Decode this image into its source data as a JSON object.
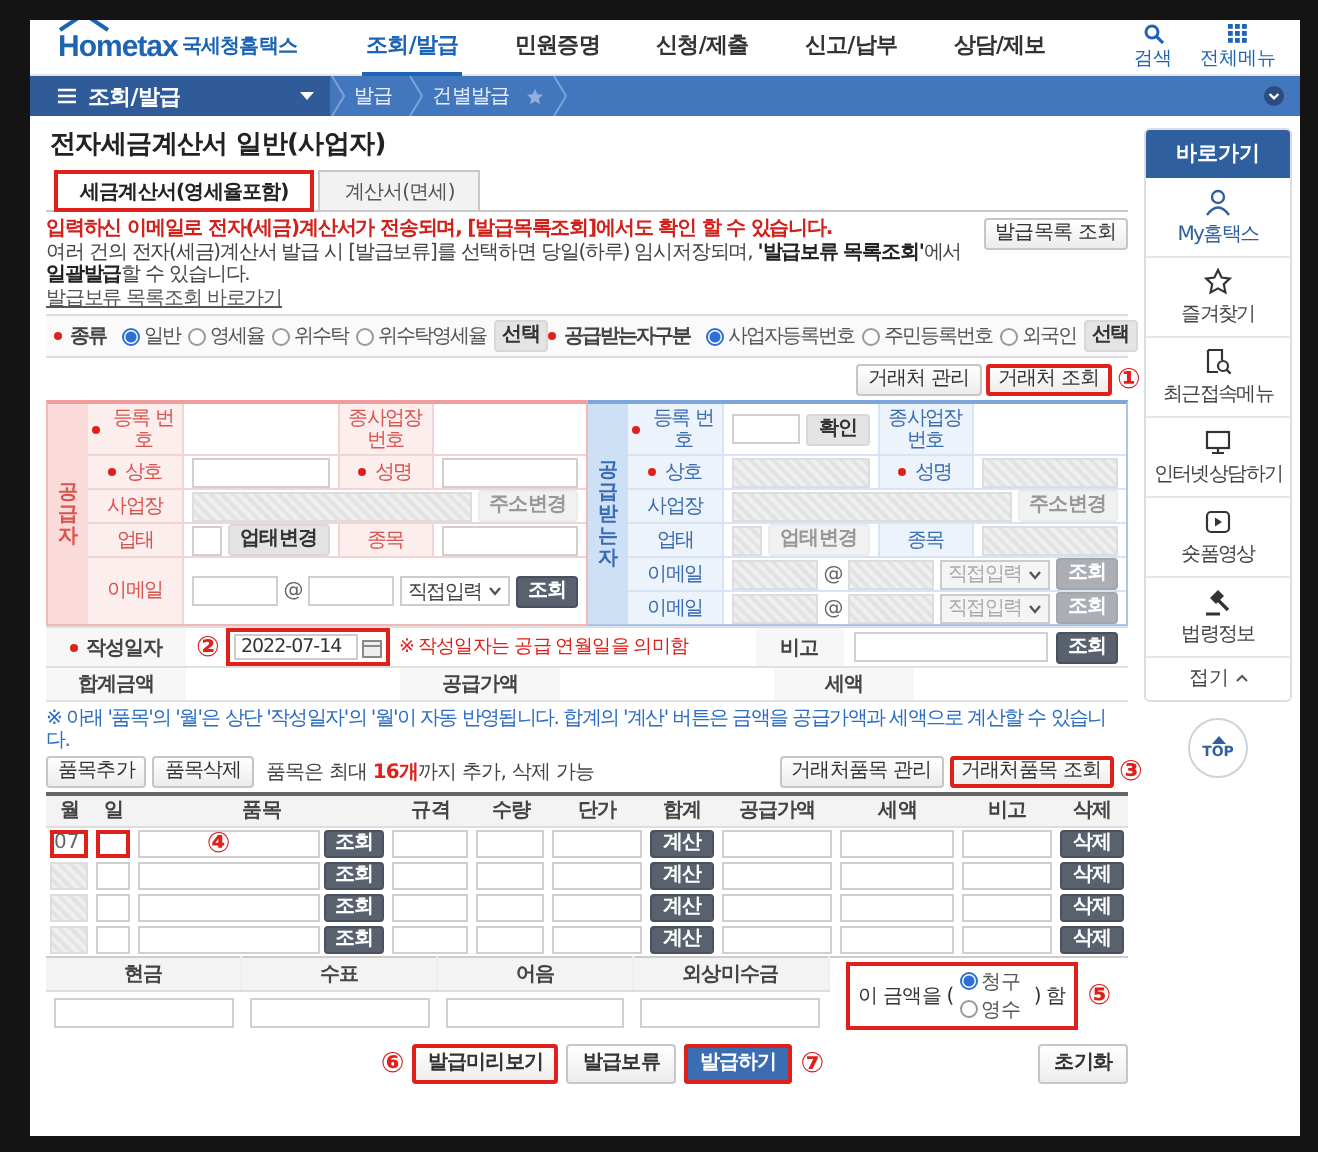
{
  "header": {
    "logo": "Hometax",
    "brand": "국세청홈택스",
    "nav": [
      {
        "label": "조회/발급",
        "selected": true
      },
      {
        "label": "민원증명",
        "selected": false
      },
      {
        "label": "신청/제출",
        "selected": false
      },
      {
        "label": "신고/납부",
        "selected": false
      },
      {
        "label": "상담/제보",
        "selected": false
      }
    ],
    "utilities": [
      {
        "kind": "search",
        "label": "검색"
      },
      {
        "kind": "menu",
        "label": "전체메뉴"
      }
    ]
  },
  "breadcrumb": {
    "menu": "조회/발급",
    "items": [
      "발급",
      "건별발급"
    ],
    "favorite": false
  },
  "page_title": "전자세금계산서 일반(사업자)",
  "tabs": [
    {
      "label": "세금계산서(영세율포함)",
      "selected": true,
      "highlighted": true
    },
    {
      "label": "계산서(면세)",
      "selected": false,
      "highlighted": false
    }
  ],
  "notices": [
    {
      "kind": "warning",
      "text": "입력하신 이메일로 전자(세금)계산서가 전송되며, [발급목록조회]에서도 확인 할 수 있습니다."
    },
    {
      "kind": "info",
      "text": "여러 건의 전자(세금)계산서 발급 시 [발급보류]를 선택하면 당일(하루) 임시저장되며, **'발급보류 목록조회'**에서 **일괄발급**할 수 있습니다."
    },
    {
      "kind": "link",
      "text": "발급보류 목록조회 바로가기"
    }
  ],
  "list_button": "발급목록 조회",
  "type_row": [
    {
      "label": "종류",
      "required": true,
      "options": [
        {
          "label": "일반",
          "selected": true
        },
        {
          "label": "영세율",
          "selected": false
        },
        {
          "label": "위수탁",
          "selected": false
        },
        {
          "label": "위수탁영세율",
          "selected": false
        }
      ],
      "button": "선택"
    },
    {
      "label": "공급받는자구분",
      "required": true,
      "options": [
        {
          "label": "사업자등록번호",
          "selected": true
        },
        {
          "label": "주민등록번호",
          "selected": false
        },
        {
          "label": "외국인",
          "selected": false
        }
      ],
      "button": "선택"
    }
  ],
  "partner_buttons": [
    {
      "label": "거래처 관리",
      "highlighted": false
    },
    {
      "label": "거래처 조회",
      "highlighted": true,
      "callout": "①"
    }
  ],
  "supplier": {
    "title": "공급자",
    "rows": [
      [
        {
          "label": "등록 번호",
          "required": true
        },
        {
          "label": "종사업장 번호",
          "required": false
        }
      ],
      [
        {
          "label": "상호",
          "required": true,
          "controls": [
            {
              "kind": "input",
              "disabled": false
            }
          ]
        },
        {
          "label": "성명",
          "required": true,
          "controls": [
            {
              "kind": "input",
              "disabled": false
            }
          ]
        }
      ],
      [
        {
          "label": "사업장",
          "required": false,
          "controls": [
            {
              "kind": "input",
              "disabled": true
            },
            {
              "kind": "button",
              "label": "주소변경",
              "disabled": true
            }
          ]
        }
      ],
      [
        {
          "label": "업태",
          "required": false,
          "controls": [
            {
              "kind": "input",
              "disabled": false
            },
            {
              "kind": "button",
              "label": "업태변경",
              "disabled": false
            }
          ]
        },
        {
          "label": "종목",
          "required": false,
          "controls": [
            {
              "kind": "input",
              "disabled": false
            }
          ]
        }
      ],
      [
        {
          "label": "이메일",
          "required": false,
          "controls": [
            {
              "kind": "input",
              "disabled": false
            },
            {
              "kind": "text",
              "text": "@"
            },
            {
              "kind": "input",
              "disabled": false
            },
            {
              "kind": "select",
              "value": "직접입력",
              "disabled": false
            },
            {
              "kind": "search_button",
              "label": "조회",
              "disabled": false
            }
          ]
        }
      ]
    ]
  },
  "receiver": {
    "title": "공급받는자",
    "rows": [
      [
        {
          "label": "등록 번호",
          "required": true,
          "controls": [
            {
              "kind": "input",
              "disabled": false
            },
            {
              "kind": "button",
              "label": "확인",
              "disabled": false
            }
          ]
        },
        {
          "label": "종사업장 번호",
          "required": false
        }
      ],
      [
        {
          "label": "상호",
          "required": true,
          "controls": [
            {
              "kind": "input",
              "disabled": true
            }
          ]
        },
        {
          "label": "성명",
          "required": true,
          "controls": [
            {
              "kind": "input",
              "disabled": true
            }
          ]
        }
      ],
      [
        {
          "label": "사업장",
          "required": false,
          "controls": [
            {
              "kind": "input",
              "disabled": true
            },
            {
              "kind": "button",
              "label": "주소변경",
              "disabled": true
            }
          ]
        }
      ],
      [
        {
          "label": "업태",
          "required": false,
          "controls": [
            {
              "kind": "input",
              "disabled": true
            },
            {
              "kind": "button",
              "label": "업태변경",
              "disabled": true
            }
          ]
        },
        {
          "label": "종목",
          "required": false,
          "controls": [
            {
              "kind": "input",
              "disabled": true
            }
          ]
        }
      ],
      [
        {
          "label": "이메일",
          "required": false,
          "controls": [
            {
              "kind": "input",
              "disabled": true
            },
            {
              "kind": "text",
              "text": "@"
            },
            {
              "kind": "input",
              "disabled": true
            },
            {
              "kind": "select",
              "value": "직접입력",
              "disabled": true
            },
            {
              "kind": "search_button",
              "label": "조회",
              "disabled": true
            }
          ]
        }
      ],
      [
        {
          "label": "이메일",
          "required": false,
          "controls": [
            {
              "kind": "input",
              "disabled": true
            },
            {
              "kind": "text",
              "text": "@"
            },
            {
              "kind": "input",
              "disabled": true
            },
            {
              "kind": "select",
              "value": "직접입력",
              "disabled": true
            },
            {
              "kind": "search_button",
              "label": "조회",
              "disabled": true
            }
          ]
        }
      ]
    ]
  },
  "date_row": {
    "label": "작성일자",
    "required": true,
    "date": {
      "value": "2022-07-14",
      "highlighted": true,
      "callout": "②"
    },
    "note": "※ 작성일자는 공급 연월일을 의미함",
    "memo_label": "비고",
    "memo_button": "조회"
  },
  "sum_row": {
    "labels": [
      "합계금액",
      "공급가액",
      "세액"
    ]
  },
  "items": {
    "note": "※ 아래 '품목'의 '월'은 상단 '작성일자'의 '월'이 자동 반영됩니다. 합계의 '계산' 버튼은 금액을 공급가액과 세액으로 계산할 수 있습니다.",
    "add_button": "품목추가",
    "delete_button": "품목삭제",
    "limit_text": "품목은 최대 **16개**까지 추가, 삭제 가능",
    "manage_buttons": [
      {
        "label": "거래처품목 관리",
        "highlighted": false
      },
      {
        "label": "거래처품목 조회",
        "highlighted": true,
        "callout": "③"
      }
    ],
    "columns": [
      "월",
      "일",
      "품목",
      "규격",
      "수량",
      "단가",
      "합계",
      "공급가액",
      "세액",
      "비고",
      "삭제"
    ],
    "rows": [
      {
        "month": "07",
        "month_disabled": false,
        "lookup": "조회",
        "calc": "계산",
        "delete": "삭제",
        "highlighted": true,
        "callout": "④"
      },
      {
        "month_disabled": true,
        "lookup": "조회",
        "calc": "계산",
        "delete": "삭제",
        "highlighted": false
      },
      {
        "month_disabled": true,
        "lookup": "조회",
        "calc": "계산",
        "delete": "삭제",
        "highlighted": false
      },
      {
        "month_disabled": true,
        "lookup": "조회",
        "calc": "계산",
        "delete": "삭제",
        "highlighted": false
      }
    ]
  },
  "payment": {
    "columns": [
      "현금",
      "수표",
      "어음",
      "외상미수금"
    ],
    "claim": {
      "prefix": "이 금액을 (",
      "options": [
        {
          "label": "청구",
          "selected": true
        },
        {
          "label": "영수",
          "selected": false
        }
      ],
      "suffix": ") 함",
      "highlighted": true,
      "callout": "⑤"
    }
  },
  "actions": [
    {
      "label": "발급미리보기",
      "kind": "normal",
      "highlighted": true,
      "callout": "⑥"
    },
    {
      "label": "발급보류",
      "kind": "normal",
      "highlighted": false
    },
    {
      "label": "발급하기",
      "kind": "primary",
      "highlighted": true,
      "callout": "⑦"
    }
  ],
  "reset_button": "초기화",
  "sidebar": {
    "title": "바로가기",
    "items": [
      {
        "kind": "person",
        "label": "My홈택스"
      },
      {
        "kind": "star",
        "label": "즐겨찾기"
      },
      {
        "kind": "recent",
        "label": "최근접속메뉴"
      },
      {
        "kind": "monitor",
        "label": "인터넷상담하기"
      },
      {
        "kind": "play",
        "label": "숏폼영상"
      },
      {
        "kind": "gavel",
        "label": "법령정보"
      }
    ],
    "collapse": "접기",
    "top": "TOP"
  }
}
